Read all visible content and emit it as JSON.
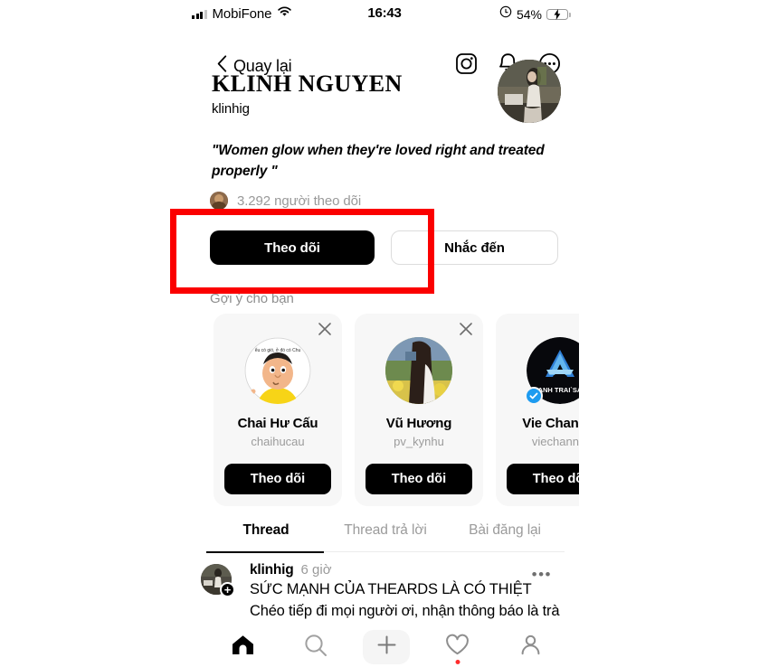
{
  "status_bar": {
    "carrier": "MobiFone",
    "time": "16:43",
    "battery_percent": "54%",
    "signal_icon": "cellular-bars-icon",
    "wifi_icon": "wifi-icon",
    "lock_icon": "rotation-lock-icon",
    "battery_icon": "battery-charging-icon",
    "battery_color": "#2fd158"
  },
  "nav": {
    "back_label": "Quay lại",
    "back_icon": "chevron-left-icon",
    "instagram_icon": "instagram-icon",
    "bell_icon": "bell-icon",
    "more_icon": "more-circle-icon"
  },
  "profile": {
    "name": "KLINH NGUYEN",
    "handle": "klinhig",
    "bio": "\"Women glow when they're loved right and treated properly \"",
    "followers_text": "3.292 người theo dõi",
    "avatar_icon": "profile-avatar",
    "follower_avatar_icon": "follower-avatar"
  },
  "actions": {
    "follow_label": "Theo dõi",
    "mention_label": "Nhắc đến"
  },
  "annotation": {
    "color": "#fb0000",
    "target": "follow-button"
  },
  "suggestions": {
    "title": "Gợi ý cho bạn",
    "close_icon": "close-icon",
    "cards": [
      {
        "name": "Chai Hư Cấu",
        "handle": "chaihucau",
        "button_label": "Theo dõi",
        "avatar_icon": "cartoon-avatar",
        "verified": false
      },
      {
        "name": "Vũ Hương",
        "handle": "pv_kynhu",
        "button_label": "Theo dõi",
        "avatar_icon": "photo-avatar",
        "verified": false
      },
      {
        "name": "Vie Channel",
        "handle": "viechannel",
        "button_label": "Theo dõi",
        "avatar_icon": "anh-trai-say-hi-avatar",
        "verified": true,
        "verified_color": "#1d9bf0"
      }
    ]
  },
  "tabs": [
    {
      "label": "Thread",
      "active": true
    },
    {
      "label": "Thread trả lời",
      "active": false
    },
    {
      "label": "Bài đăng lại",
      "active": false
    }
  ],
  "post": {
    "username": "klinhig",
    "time": "6 giờ",
    "line1": "SỨC MẠNH CỦA THEARDS LÀ CÓ THIỆT",
    "line2": "Chéo tiếp đi mọi người ơi, nhận thông báo là trà",
    "more_icon": "more-horizontal-icon",
    "avatar_icon": "post-author-avatar",
    "plus_badge": "+"
  },
  "bottom_nav": [
    {
      "icon": "home-icon",
      "active": true,
      "badge": false
    },
    {
      "icon": "search-icon",
      "active": false,
      "badge": false
    },
    {
      "icon": "plus-icon",
      "active": false,
      "badge": false
    },
    {
      "icon": "heart-icon",
      "active": false,
      "badge": true
    },
    {
      "icon": "person-icon",
      "active": false,
      "badge": false
    }
  ]
}
